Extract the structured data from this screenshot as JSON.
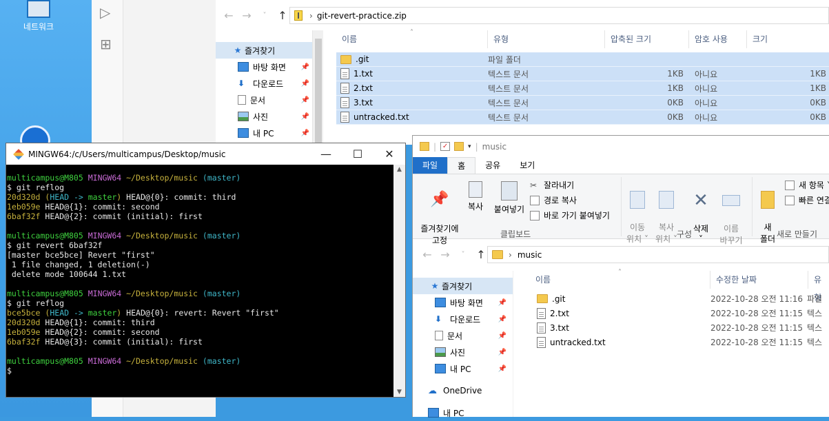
{
  "desktop": {
    "network_label": "네트워크"
  },
  "zip_window": {
    "address": "git-revert-practice.zip",
    "sidebar": [
      {
        "label": "즐겨찾기",
        "icon": "star-icon"
      },
      {
        "label": "바탕 화면",
        "icon": "desktop-icon"
      },
      {
        "label": "다운로드",
        "icon": "download-icon"
      },
      {
        "label": "문서",
        "icon": "document-icon"
      },
      {
        "label": "사진",
        "icon": "picture-icon"
      },
      {
        "label": "내 PC",
        "icon": "pc-icon"
      }
    ],
    "columns": [
      "이름",
      "유형",
      "압축된 크기",
      "암호 사용",
      "크기"
    ],
    "rows": [
      {
        "name": ".git",
        "type": "파일 폴더",
        "packed": "",
        "protected": "",
        "size": ""
      },
      {
        "name": "1.txt",
        "type": "텍스트 문서",
        "packed": "1KB",
        "protected": "아니요",
        "size": "1KB"
      },
      {
        "name": "2.txt",
        "type": "텍스트 문서",
        "packed": "1KB",
        "protected": "아니요",
        "size": "1KB"
      },
      {
        "name": "3.txt",
        "type": "텍스트 문서",
        "packed": "0KB",
        "protected": "아니요",
        "size": "0KB"
      },
      {
        "name": "untracked.txt",
        "type": "텍스트 문서",
        "packed": "0KB",
        "protected": "아니요",
        "size": "0KB"
      }
    ]
  },
  "music_window": {
    "title": "music",
    "tabs": [
      "파일",
      "홈",
      "공유",
      "보기"
    ],
    "ribbon": {
      "pin": "즐겨찾기에\n고정",
      "copy": "복사",
      "paste": "붙여넣기",
      "cut": "잘라내기",
      "copy_path": "경로 복사",
      "paste_shortcut": "바로 가기 붙여넣기",
      "clipboard_group": "클립보드",
      "move_to": "이동\n위치 ˅",
      "copy_to": "복사\n위치 ˅",
      "delete": "삭제\n˅",
      "rename": "이름\n바꾸기",
      "organize_group": "구성",
      "new_folder": "새\n폴더",
      "new_item": "새 항목 ˅",
      "easy_access": "빠른 연결",
      "new_group": "새로 만들기"
    },
    "address": "music",
    "sidebar": [
      {
        "label": "즐겨찾기",
        "icon": "star-icon"
      },
      {
        "label": "바탕 화면",
        "icon": "desktop-icon"
      },
      {
        "label": "다운로드",
        "icon": "download-icon"
      },
      {
        "label": "문서",
        "icon": "document-icon"
      },
      {
        "label": "사진",
        "icon": "picture-icon"
      },
      {
        "label": "내 PC",
        "icon": "pc-icon"
      },
      {
        "label": "OneDrive",
        "icon": "cloud-icon"
      },
      {
        "label": "내 PC",
        "icon": "pc-icon"
      }
    ],
    "columns": [
      "이름",
      "수정한 날짜",
      "유형"
    ],
    "rows": [
      {
        "name": ".git",
        "date": "2022-10-28 오전 11:16",
        "type": "파일"
      },
      {
        "name": "2.txt",
        "date": "2022-10-28 오전 11:15",
        "type": "텍스"
      },
      {
        "name": "3.txt",
        "date": "2022-10-28 오전 11:15",
        "type": "텍스"
      },
      {
        "name": "untracked.txt",
        "date": "2022-10-28 오전 11:15",
        "type": "텍스"
      }
    ]
  },
  "terminal": {
    "title": "MINGW64:/c/Users/multicampus/Desktop/music",
    "prompt_user": "multicampus@M805",
    "prompt_sys": "MINGW64",
    "prompt_path": "~/Desktop/music",
    "prompt_branch": "(master)",
    "lines": [
      {
        "kind": "prompt"
      },
      {
        "kind": "text",
        "text": "$ git reflog"
      },
      {
        "kind": "reflog",
        "hash": "20d320d",
        "deco": true,
        "ref": "HEAD@{0}: commit: third"
      },
      {
        "kind": "reflog",
        "hash": "1eb059e",
        "deco": false,
        "ref": "HEAD@{1}: commit: second"
      },
      {
        "kind": "reflog",
        "hash": "6baf32f",
        "deco": false,
        "ref": "HEAD@{2}: commit (initial): first"
      },
      {
        "kind": "blank"
      },
      {
        "kind": "prompt"
      },
      {
        "kind": "text",
        "text": "$ git revert 6baf32f"
      },
      {
        "kind": "text",
        "text": "[master bce5bce] Revert \"first\""
      },
      {
        "kind": "text",
        "text": " 1 file changed, 1 deletion(-)"
      },
      {
        "kind": "text",
        "text": " delete mode 100644 1.txt"
      },
      {
        "kind": "blank"
      },
      {
        "kind": "prompt"
      },
      {
        "kind": "text",
        "text": "$ git reflog"
      },
      {
        "kind": "reflog",
        "hash": "bce5bce",
        "deco": true,
        "ref": "HEAD@{0}: revert: Revert \"first\""
      },
      {
        "kind": "reflog",
        "hash": "20d320d",
        "deco": false,
        "ref": "HEAD@{1}: commit: third"
      },
      {
        "kind": "reflog",
        "hash": "1eb059e",
        "deco": false,
        "ref": "HEAD@{2}: commit: second"
      },
      {
        "kind": "reflog",
        "hash": "6baf32f",
        "deco": false,
        "ref": "HEAD@{3}: commit (initial): first"
      },
      {
        "kind": "blank"
      },
      {
        "kind": "prompt"
      },
      {
        "kind": "text",
        "text": "$"
      }
    ],
    "deco_text": "(HEAD -> master)"
  }
}
